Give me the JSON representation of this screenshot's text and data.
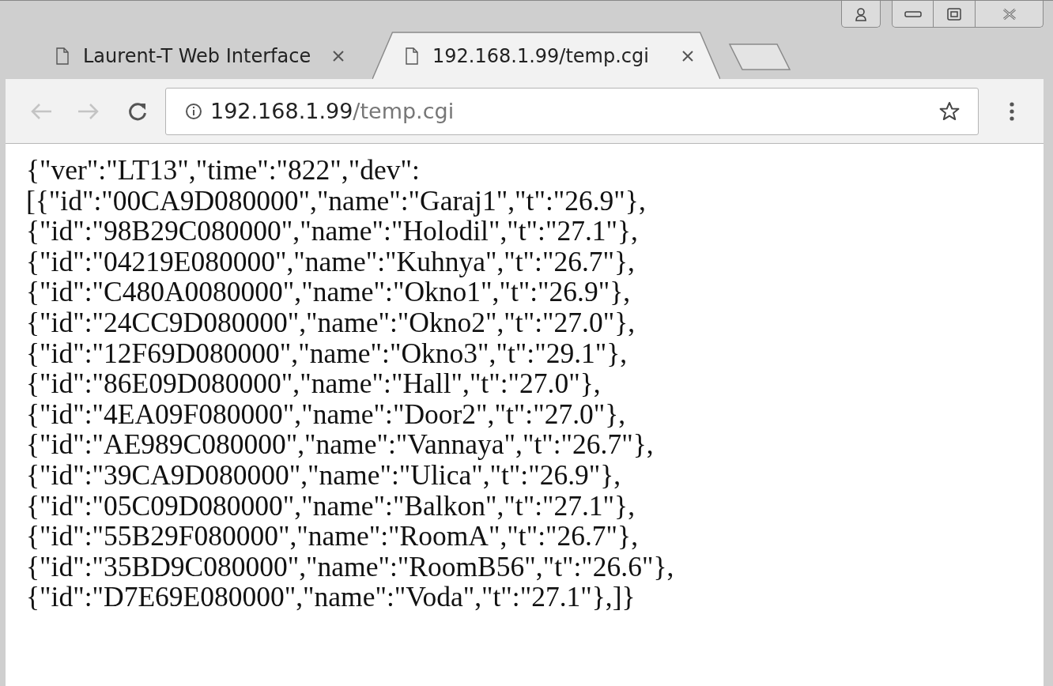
{
  "tabs": [
    {
      "title": "Laurent-T Web Interface",
      "selected": false
    },
    {
      "title": "192.168.1.99/temp.cgi",
      "selected": true
    }
  ],
  "address_bar": {
    "host": "192.168.1.99",
    "path": "/temp.cgi"
  },
  "page_lines": [
    "{\"ver\":\"LT13\",\"time\":\"822\",\"dev\":",
    "[{\"id\":\"00CA9D080000\",\"name\":\"Garaj1\",\"t\":\"26.9\"},",
    "{\"id\":\"98B29C080000\",\"name\":\"Holodil\",\"t\":\"27.1\"},",
    "{\"id\":\"04219E080000\",\"name\":\"Kuhnya\",\"t\":\"26.7\"},",
    "{\"id\":\"C480A0080000\",\"name\":\"Okno1\",\"t\":\"26.9\"},",
    "{\"id\":\"24CC9D080000\",\"name\":\"Okno2\",\"t\":\"27.0\"},",
    "{\"id\":\"12F69D080000\",\"name\":\"Okno3\",\"t\":\"29.1\"},",
    "{\"id\":\"86E09D080000\",\"name\":\"Hall\",\"t\":\"27.0\"},",
    "{\"id\":\"4EA09F080000\",\"name\":\"Door2\",\"t\":\"27.0\"},",
    "{\"id\":\"AE989C080000\",\"name\":\"Vannaya\",\"t\":\"26.7\"},",
    "{\"id\":\"39CA9D080000\",\"name\":\"Ulica\",\"t\":\"26.9\"},",
    "{\"id\":\"05C09D080000\",\"name\":\"Balkon\",\"t\":\"27.1\"},",
    "{\"id\":\"55B29F080000\",\"name\":\"RoomA\",\"t\":\"26.7\"},",
    "{\"id\":\"35BD9C080000\",\"name\":\"RoomB56\",\"t\":\"26.6\"},",
    "{\"id\":\"D7E69E080000\",\"name\":\"Voda\",\"t\":\"27.1\"},]}"
  ]
}
